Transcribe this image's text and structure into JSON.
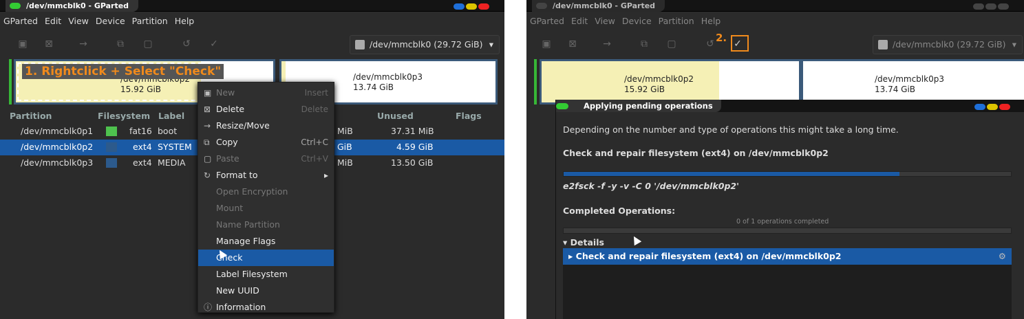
{
  "left": {
    "title": "/dev/mmcblk0 - GParted",
    "menu": [
      "GParted",
      "Edit",
      "View",
      "Device",
      "Partition",
      "Help"
    ],
    "device": "/dev/mmcblk0 (29.72 GiB)",
    "annotation": "1. Rightclick + Select \"Check\"",
    "partitions_map": [
      {
        "name": "/dev/mmcblk0p2",
        "size": "15.92 GiB"
      },
      {
        "name": "/dev/mmcblk0p3",
        "size": "13.74 GiB"
      }
    ],
    "columns": [
      "Partition",
      "Filesystem",
      "Label",
      "Unused",
      "Flags"
    ],
    "rows": [
      {
        "partition": "/dev/mmcblk0p1",
        "fs": "fat16",
        "label": "boot",
        "used_tail": "MiB",
        "unused": "37.31 MiB",
        "color": "#4ec24e"
      },
      {
        "partition": "/dev/mmcblk0p2",
        "fs": "ext4",
        "label": "SYSTEM",
        "used_tail": "GiB",
        "unused": "4.59 GiB",
        "color": "#2c5a8c"
      },
      {
        "partition": "/dev/mmcblk0p3",
        "fs": "ext4",
        "label": "MEDIA",
        "used_tail": "MiB",
        "unused": "13.50 GiB",
        "color": "#2c5a8c"
      }
    ],
    "context_menu": [
      {
        "label": "New",
        "shortcut": "Insert",
        "icon": "new-icon",
        "disabled": true
      },
      {
        "label": "Delete",
        "shortcut": "Delete",
        "icon": "delete-icon",
        "disabled": false
      },
      {
        "label": "Resize/Move",
        "shortcut": "",
        "icon": "resize-icon",
        "disabled": false
      },
      {
        "label": "Copy",
        "shortcut": "Ctrl+C",
        "icon": "copy-icon",
        "disabled": false
      },
      {
        "label": "Paste",
        "shortcut": "Ctrl+V",
        "icon": "paste-icon",
        "disabled": true
      },
      {
        "label": "Format to",
        "shortcut": "",
        "icon": "format-icon",
        "disabled": false
      },
      {
        "label": "Open Encryption",
        "shortcut": "",
        "icon": "",
        "disabled": true
      },
      {
        "label": "Mount",
        "shortcut": "",
        "icon": "",
        "disabled": true
      },
      {
        "label": "Name Partition",
        "shortcut": "",
        "icon": "",
        "disabled": true
      },
      {
        "label": "Manage Flags",
        "shortcut": "",
        "icon": "",
        "disabled": false
      },
      {
        "label": "Check",
        "shortcut": "",
        "icon": "",
        "disabled": false
      },
      {
        "label": "Label Filesystem",
        "shortcut": "",
        "icon": "",
        "disabled": false
      },
      {
        "label": "New UUID",
        "shortcut": "",
        "icon": "",
        "disabled": false
      },
      {
        "label": "Information",
        "shortcut": "",
        "icon": "info-icon",
        "disabled": false
      }
    ]
  },
  "right": {
    "title": "/dev/mmcblk0 - GParted",
    "menu": [
      "GParted",
      "Edit",
      "View",
      "Device",
      "Partition",
      "Help"
    ],
    "device": "/dev/mmcblk0 (29.72 GiB)",
    "annotation": "2.",
    "partitions_map": [
      {
        "name": "/dev/mmcblk0p2",
        "size": "15.92 GiB"
      },
      {
        "name": "/dev/mmcblk0p3",
        "size": "13.74 GiB"
      }
    ],
    "dialog": {
      "title": "Applying pending operations",
      "intro": "Depending on the number and type of operations this might take a long time.",
      "operation": "Check and repair filesystem (ext4) on /dev/mmcblk0p2",
      "command": "e2fsck -f -y -v -C 0 '/dev/mmcblk0p2'",
      "completed_label": "Completed Operations:",
      "completed_count": "0 of 1 operations completed",
      "details_label": "Details",
      "detail_row": "Check and repair filesystem (ext4) on /dev/mmcblk0p2",
      "progress": 0.75
    }
  }
}
